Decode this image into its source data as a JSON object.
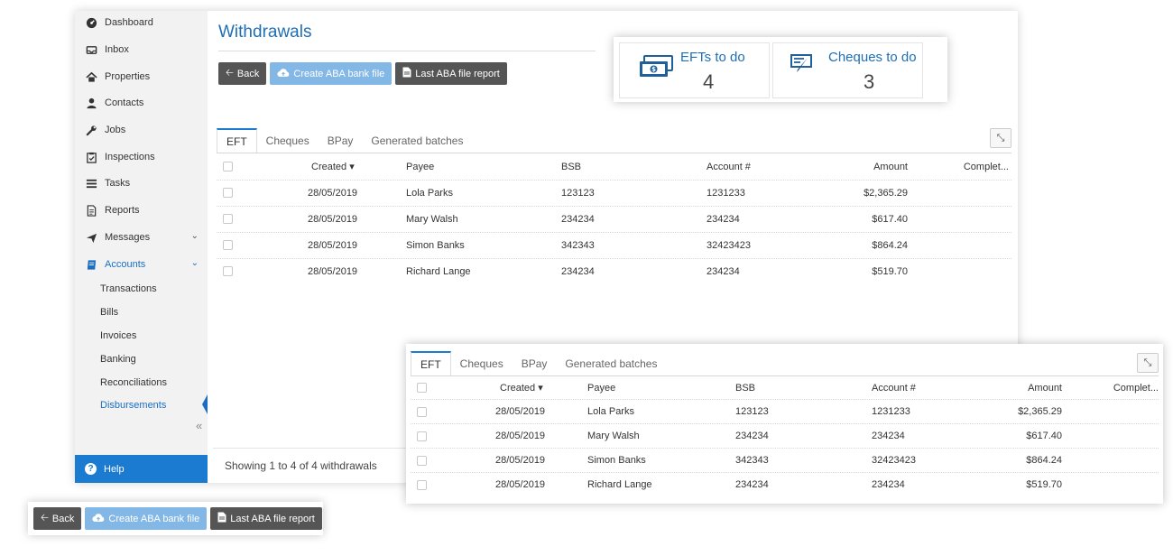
{
  "sidebar": {
    "items": [
      {
        "label": "Dashboard",
        "icon": "dashboard-icon"
      },
      {
        "label": "Inbox",
        "icon": "inbox-icon"
      },
      {
        "label": "Properties",
        "icon": "home-icon"
      },
      {
        "label": "Contacts",
        "icon": "user-icon"
      },
      {
        "label": "Jobs",
        "icon": "wrench-icon"
      },
      {
        "label": "Inspections",
        "icon": "clipboard-check-icon"
      },
      {
        "label": "Tasks",
        "icon": "list-icon"
      },
      {
        "label": "Reports",
        "icon": "document-icon"
      },
      {
        "label": "Messages",
        "icon": "send-icon"
      },
      {
        "label": "Accounts",
        "icon": "book-icon"
      }
    ],
    "subitems": [
      "Transactions",
      "Bills",
      "Invoices",
      "Banking",
      "Reconciliations",
      "Disbursements"
    ],
    "collapse_glyph": "«",
    "help_label": "Help"
  },
  "page": {
    "title": "Withdrawals",
    "footer": "Showing 1 to 4 of 4 withdrawals"
  },
  "buttons": {
    "back": "Back",
    "create_aba": "Create ABA bank file",
    "last_aba": "Last ABA file report"
  },
  "stats": {
    "efts_label": "EFTs to do",
    "efts_value": "4",
    "cheques_label": "Cheques to do",
    "cheques_value": "3"
  },
  "tabs": [
    "EFT",
    "Cheques",
    "BPay",
    "Generated batches"
  ],
  "table": {
    "headers": [
      "Created",
      "Payee",
      "BSB",
      "Account #",
      "Amount",
      "Complet..."
    ],
    "rows": [
      [
        "28/05/2019",
        "Lola Parks",
        "123123",
        "1231233",
        "$2,365.29"
      ],
      [
        "28/05/2019",
        "Mary Walsh",
        "234234",
        "234234",
        "$617.40"
      ],
      [
        "28/05/2019",
        "Simon Banks",
        "342343",
        "32423423",
        "$864.24"
      ],
      [
        "28/05/2019",
        "Richard Lange",
        "234234",
        "234234",
        "$519.70"
      ]
    ]
  },
  "colors": {
    "accent": "#1a7bd0",
    "title": "#1f6fb4",
    "button_dark": "#555555",
    "button_light": "#83b7e6"
  }
}
